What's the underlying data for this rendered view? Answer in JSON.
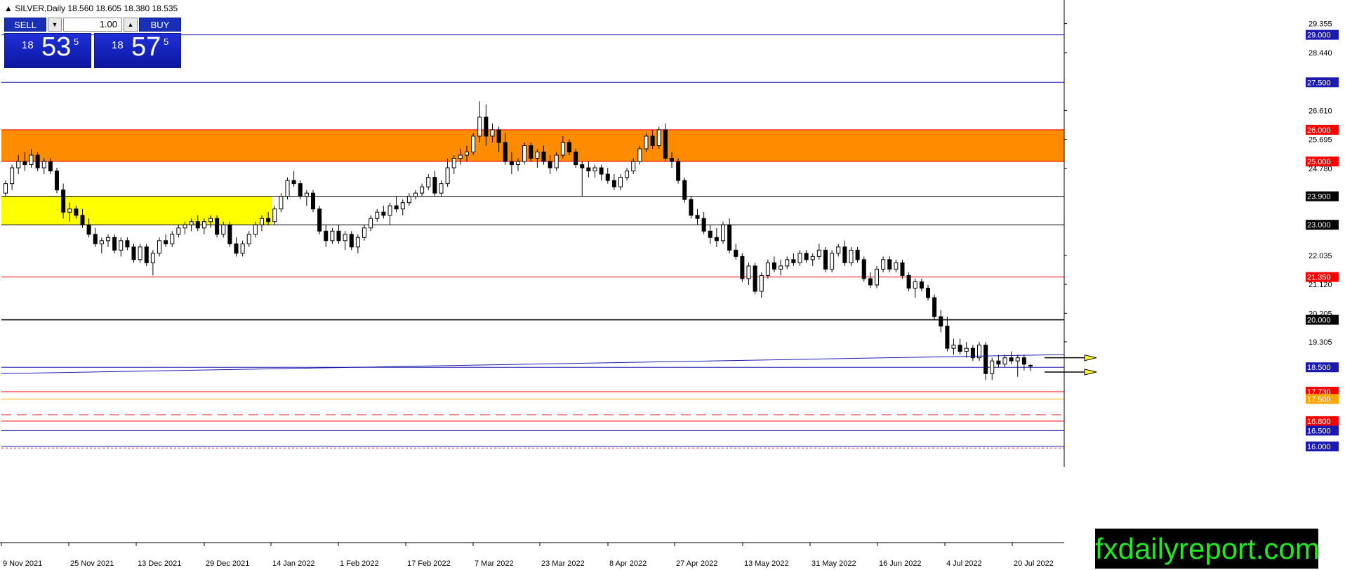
{
  "header": {
    "symbol_info": "▲ SILVER,Daily  18.560 18.605 18.380 18.535"
  },
  "trade_panel": {
    "sell_label": "SELL",
    "buy_label": "BUY",
    "lot_value": "1.00",
    "down_arrow": "▼",
    "up_arrow": "▲",
    "bid_big": "18",
    "bid_main": "53",
    "bid_sup": "5",
    "ask_big": "18",
    "ask_main": "57",
    "ask_sup": "5"
  },
  "watermark": "fxdailyreport.com",
  "colors": {
    "orange_zone": "#ff8c00",
    "yellow_zone": "#ffff00",
    "blue_line": "#1a1ab0",
    "red_line": "#ff0000",
    "black_line": "#000000",
    "watermark_text": "#22e822"
  },
  "chart_data": {
    "type": "candlestick",
    "symbol": "SILVER",
    "timeframe": "Daily",
    "ylim": [
      15.8,
      30.1
    ],
    "price_ticks": [
      "29.355",
      "28.440",
      "26.610",
      "25.695",
      "24.780",
      "22.035",
      "21.120",
      "20.205",
      "19.305"
    ],
    "date_labels": [
      "9 Nov 2021",
      "25 Nov 2021",
      "13 Dec 2021",
      "29 Dec 2021",
      "14 Jan 2022",
      "1 Feb 2022",
      "17 Feb 2022",
      "7 Mar 2022",
      "23 Mar 2022",
      "8 Apr 2022",
      "27 Apr 2022",
      "13 May 2022",
      "31 May 2022",
      "16 Jun 2022",
      "4 Jul 2022",
      "20 Jul 2022"
    ],
    "levels": [
      {
        "label": "29.000",
        "value": 29.0,
        "style": "blue"
      },
      {
        "label": "27.500",
        "value": 27.5,
        "style": "blue"
      },
      {
        "label": "26.000",
        "value": 26.0,
        "style": "red"
      },
      {
        "label": "25.000",
        "value": 25.0,
        "style": "red"
      },
      {
        "label": "23.900",
        "value": 23.9,
        "style": "black"
      },
      {
        "label": "23.000",
        "value": 23.0,
        "style": "black"
      },
      {
        "label": "21.350",
        "value": 21.35,
        "style": "red"
      },
      {
        "label": "20.000",
        "value": 20.0,
        "style": "black"
      },
      {
        "label": "18.500",
        "value": 18.5,
        "style": "blue"
      },
      {
        "label": "17.730",
        "value": 17.73,
        "style": "red"
      },
      {
        "label": "17.500",
        "value": 17.5,
        "style": "orange"
      },
      {
        "label": "16.800",
        "value": 16.8,
        "style": "red"
      },
      {
        "label": "16.500",
        "value": 16.5,
        "style": "blue"
      },
      {
        "label": "16.000",
        "value": 16.0,
        "style": "blue"
      }
    ],
    "zones": [
      {
        "name": "resistance",
        "from": 25.0,
        "to": 26.0,
        "color": "orange"
      },
      {
        "name": "support-resistance",
        "from": 23.0,
        "to": 23.9,
        "color": "yellow",
        "x_from": "9 Nov 2021",
        "x_to": "14 Jan 2022"
      }
    ],
    "series": [
      {
        "values": [
          [
            24.0,
            24.4,
            23.9,
            24.3
          ],
          [
            24.3,
            24.9,
            24.1,
            24.8
          ],
          [
            24.8,
            25.2,
            24.6,
            25.0
          ],
          [
            25.0,
            25.3,
            24.7,
            24.9
          ],
          [
            24.9,
            25.4,
            24.8,
            25.2
          ],
          [
            25.2,
            25.3,
            24.7,
            24.8
          ],
          [
            24.8,
            25.1,
            24.6,
            25.0
          ],
          [
            25.0,
            25.1,
            24.6,
            24.7
          ],
          [
            24.7,
            24.8,
            24.0,
            24.1
          ],
          [
            24.1,
            24.3,
            23.2,
            23.4
          ],
          [
            23.4,
            23.7,
            23.1,
            23.5
          ],
          [
            23.5,
            23.6,
            23.2,
            23.3
          ],
          [
            23.3,
            23.5,
            22.9,
            23.0
          ],
          [
            23.0,
            23.2,
            22.6,
            22.7
          ],
          [
            22.7,
            22.9,
            22.3,
            22.4
          ],
          [
            22.4,
            22.6,
            22.1,
            22.5
          ],
          [
            22.5,
            22.7,
            22.3,
            22.6
          ],
          [
            22.6,
            22.7,
            22.1,
            22.2
          ],
          [
            22.2,
            22.6,
            22.0,
            22.5
          ],
          [
            22.5,
            22.6,
            22.2,
            22.3
          ],
          [
            22.3,
            22.4,
            21.8,
            21.9
          ],
          [
            21.9,
            22.4,
            21.8,
            22.3
          ],
          [
            22.3,
            22.4,
            21.7,
            21.8
          ],
          [
            21.8,
            22.2,
            21.4,
            22.1
          ],
          [
            22.1,
            22.6,
            22.0,
            22.5
          ],
          [
            22.5,
            22.7,
            22.3,
            22.4
          ],
          [
            22.4,
            22.8,
            22.3,
            22.7
          ],
          [
            22.7,
            23.0,
            22.6,
            22.9
          ],
          [
            22.9,
            23.1,
            22.7,
            23.0
          ],
          [
            23.0,
            23.2,
            22.8,
            23.1
          ],
          [
            23.1,
            23.3,
            22.8,
            22.9
          ],
          [
            22.9,
            23.2,
            22.7,
            23.1
          ],
          [
            23.1,
            23.3,
            22.9,
            23.2
          ],
          [
            23.2,
            23.3,
            22.6,
            22.7
          ],
          [
            22.7,
            23.1,
            22.6,
            23.0
          ],
          [
            23.0,
            23.1,
            22.3,
            22.4
          ],
          [
            22.4,
            22.6,
            22.0,
            22.1
          ],
          [
            22.1,
            22.5,
            22.0,
            22.4
          ],
          [
            22.4,
            22.8,
            22.3,
            22.7
          ],
          [
            22.7,
            23.1,
            22.6,
            23.0
          ],
          [
            23.0,
            23.3,
            22.8,
            23.2
          ],
          [
            23.2,
            23.4,
            23.0,
            23.1
          ],
          [
            23.1,
            23.6,
            23.0,
            23.5
          ],
          [
            23.5,
            24.0,
            23.4,
            23.9
          ],
          [
            23.9,
            24.5,
            23.8,
            24.4
          ],
          [
            24.4,
            24.7,
            24.2,
            24.3
          ],
          [
            24.3,
            24.4,
            23.8,
            23.9
          ],
          [
            23.9,
            24.1,
            23.6,
            24.0
          ],
          [
            24.0,
            24.1,
            23.4,
            23.5
          ],
          [
            23.5,
            23.6,
            22.7,
            22.8
          ],
          [
            22.8,
            23.0,
            22.3,
            22.5
          ],
          [
            22.5,
            22.9,
            22.4,
            22.8
          ],
          [
            22.8,
            23.0,
            22.4,
            22.5
          ],
          [
            22.5,
            22.8,
            22.2,
            22.7
          ],
          [
            22.7,
            22.8,
            22.2,
            22.3
          ],
          [
            22.3,
            22.7,
            22.1,
            22.6
          ],
          [
            22.6,
            23.0,
            22.5,
            22.9
          ],
          [
            22.9,
            23.3,
            22.8,
            23.2
          ],
          [
            23.2,
            23.5,
            23.1,
            23.4
          ],
          [
            23.4,
            23.6,
            23.2,
            23.3
          ],
          [
            23.3,
            23.7,
            23.0,
            23.6
          ],
          [
            23.6,
            23.9,
            23.4,
            23.5
          ],
          [
            23.5,
            23.8,
            23.3,
            23.7
          ],
          [
            23.7,
            24.0,
            23.6,
            23.9
          ],
          [
            23.9,
            24.1,
            23.8,
            24.0
          ],
          [
            24.0,
            24.3,
            23.9,
            24.2
          ],
          [
            24.2,
            24.6,
            24.1,
            24.5
          ],
          [
            24.5,
            24.7,
            23.9,
            24.0
          ],
          [
            24.0,
            24.4,
            23.9,
            24.3
          ],
          [
            24.3,
            25.1,
            24.2,
            24.8
          ],
          [
            24.8,
            25.2,
            24.6,
            25.1
          ],
          [
            25.1,
            25.4,
            24.9,
            25.2
          ],
          [
            25.2,
            25.5,
            25.0,
            25.3
          ],
          [
            25.3,
            25.9,
            25.2,
            25.8
          ],
          [
            25.8,
            26.9,
            25.6,
            26.4
          ],
          [
            26.4,
            26.8,
            25.5,
            25.8
          ],
          [
            25.8,
            26.2,
            25.6,
            26.0
          ],
          [
            26.0,
            26.1,
            25.3,
            25.6
          ],
          [
            25.6,
            25.9,
            24.9,
            25.0
          ],
          [
            25.0,
            25.3,
            24.6,
            24.9
          ],
          [
            24.9,
            25.1,
            24.7,
            25.0
          ],
          [
            25.0,
            25.6,
            24.9,
            25.5
          ],
          [
            25.5,
            25.6,
            25.0,
            25.1
          ],
          [
            25.1,
            25.4,
            24.8,
            25.3
          ],
          [
            25.3,
            25.5,
            24.9,
            25.0
          ],
          [
            25.0,
            25.2,
            24.6,
            24.8
          ],
          [
            24.8,
            25.3,
            24.7,
            25.2
          ],
          [
            25.2,
            25.8,
            25.1,
            25.6
          ],
          [
            25.6,
            25.7,
            25.2,
            25.3
          ],
          [
            25.3,
            25.4,
            24.8,
            24.9
          ],
          [
            24.9,
            25.0,
            23.9,
            24.8
          ],
          [
            24.8,
            25.0,
            24.5,
            24.7
          ],
          [
            24.7,
            24.9,
            24.5,
            24.8
          ],
          [
            24.8,
            24.9,
            24.4,
            24.6
          ],
          [
            24.6,
            24.8,
            24.3,
            24.4
          ],
          [
            24.4,
            24.6,
            24.1,
            24.2
          ],
          [
            24.2,
            24.6,
            24.1,
            24.5
          ],
          [
            24.5,
            24.8,
            24.4,
            24.7
          ],
          [
            24.7,
            25.1,
            24.6,
            25.0
          ],
          [
            25.0,
            25.5,
            24.9,
            25.4
          ],
          [
            25.4,
            25.9,
            25.3,
            25.8
          ],
          [
            25.8,
            26.0,
            25.4,
            25.5
          ],
          [
            25.5,
            26.1,
            25.4,
            26.0
          ],
          [
            26.0,
            26.2,
            25.0,
            25.1
          ],
          [
            25.1,
            25.3,
            24.8,
            25.0
          ],
          [
            25.0,
            25.1,
            24.3,
            24.4
          ],
          [
            24.4,
            24.5,
            23.7,
            23.8
          ],
          [
            23.8,
            23.9,
            23.2,
            23.3
          ],
          [
            23.3,
            23.5,
            23.0,
            23.2
          ],
          [
            23.2,
            23.4,
            22.7,
            22.8
          ],
          [
            22.8,
            23.0,
            22.4,
            22.6
          ],
          [
            22.6,
            22.9,
            22.3,
            22.5
          ],
          [
            22.5,
            23.1,
            22.4,
            23.0
          ],
          [
            23.0,
            23.2,
            22.1,
            22.2
          ],
          [
            22.2,
            22.4,
            21.9,
            22.0
          ],
          [
            22.0,
            22.1,
            21.2,
            21.3
          ],
          [
            21.3,
            21.8,
            21.1,
            21.7
          ],
          [
            21.7,
            21.8,
            20.8,
            20.9
          ],
          [
            20.9,
            21.5,
            20.7,
            21.4
          ],
          [
            21.4,
            21.9,
            21.3,
            21.8
          ],
          [
            21.8,
            22.0,
            21.5,
            21.6
          ],
          [
            21.6,
            21.9,
            21.4,
            21.7
          ],
          [
            21.7,
            22.0,
            21.6,
            21.9
          ],
          [
            21.9,
            22.1,
            21.7,
            21.8
          ],
          [
            21.8,
            22.2,
            21.7,
            22.1
          ],
          [
            22.1,
            22.2,
            21.8,
            21.9
          ],
          [
            21.9,
            22.1,
            21.7,
            22.0
          ],
          [
            22.0,
            22.4,
            21.9,
            22.2
          ],
          [
            22.2,
            22.3,
            21.5,
            21.6
          ],
          [
            21.6,
            22.2,
            21.5,
            22.1
          ],
          [
            22.1,
            22.4,
            22.0,
            22.3
          ],
          [
            22.3,
            22.5,
            21.7,
            21.8
          ],
          [
            21.8,
            22.3,
            21.7,
            22.2
          ],
          [
            22.2,
            22.3,
            21.8,
            21.9
          ],
          [
            21.9,
            22.0,
            21.2,
            21.3
          ],
          [
            21.3,
            21.5,
            21.0,
            21.1
          ],
          [
            21.1,
            21.7,
            21.0,
            21.6
          ],
          [
            21.6,
            22.0,
            21.5,
            21.9
          ],
          [
            21.9,
            22.0,
            21.5,
            21.6
          ],
          [
            21.6,
            21.9,
            21.5,
            21.8
          ],
          [
            21.8,
            21.9,
            21.3,
            21.4
          ],
          [
            21.4,
            21.5,
            20.9,
            21.0
          ],
          [
            21.0,
            21.3,
            20.7,
            21.2
          ],
          [
            21.2,
            21.3,
            20.9,
            21.0
          ],
          [
            21.0,
            21.1,
            20.6,
            20.7
          ],
          [
            20.7,
            20.8,
            20.0,
            20.1
          ],
          [
            20.1,
            20.3,
            19.6,
            19.8
          ],
          [
            19.8,
            20.1,
            19.0,
            19.1
          ],
          [
            19.1,
            19.4,
            18.9,
            19.2
          ],
          [
            19.2,
            19.4,
            18.9,
            19.0
          ],
          [
            19.0,
            19.3,
            18.8,
            19.1
          ],
          [
            19.1,
            19.2,
            18.7,
            18.8
          ],
          [
            18.8,
            19.3,
            18.7,
            19.2
          ],
          [
            19.2,
            19.3,
            18.1,
            18.3
          ],
          [
            18.3,
            18.8,
            18.1,
            18.7
          ],
          [
            18.7,
            18.9,
            18.5,
            18.6
          ],
          [
            18.6,
            18.9,
            18.5,
            18.8
          ],
          [
            18.8,
            19.0,
            18.6,
            18.7
          ],
          [
            18.7,
            18.9,
            18.2,
            18.8
          ],
          [
            18.8,
            18.9,
            18.4,
            18.6
          ],
          [
            18.56,
            18.605,
            18.38,
            18.535
          ]
        ]
      }
    ]
  }
}
